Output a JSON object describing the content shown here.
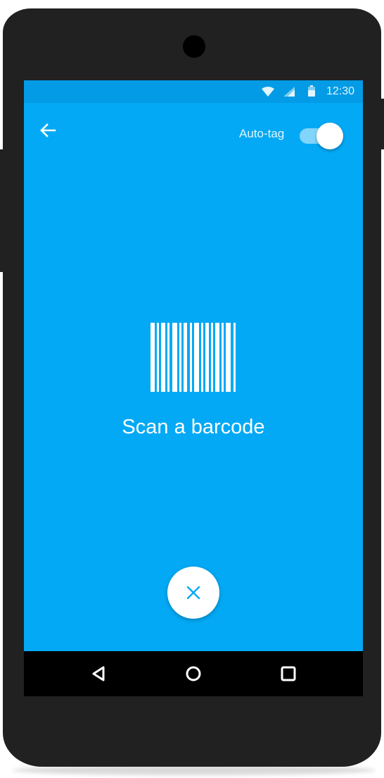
{
  "status_bar": {
    "time": "12:30",
    "icons": [
      "wifi-icon",
      "cellular-signal-icon",
      "battery-icon"
    ]
  },
  "app_bar": {
    "back_icon": "arrow-back-icon",
    "auto_tag_label": "Auto-tag",
    "auto_tag_enabled": true
  },
  "main": {
    "illustration_icon": "barcode-icon",
    "prompt": "Scan a barcode",
    "close_icon": "close-icon"
  },
  "nav_bar": {
    "buttons": [
      "back-triangle-icon",
      "home-circle-icon",
      "recents-square-icon"
    ]
  },
  "colors": {
    "screen_bg": "#03a9f4",
    "status_bar_bg": "#039be5",
    "accent": "#03a9f4",
    "phone_body": "#212121"
  }
}
